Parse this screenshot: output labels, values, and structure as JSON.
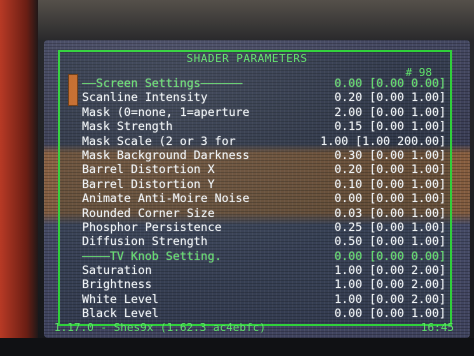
{
  "menu": {
    "title": "SHADER PARAMETERS",
    "page_counter": "# 98",
    "rows": [
      {
        "label": "——Screen Settings——————",
        "value": "0.00 [0.00 0.00]",
        "header": true
      },
      {
        "label": "Scanline Intensity",
        "value": "0.20 [0.00 1.00]"
      },
      {
        "label": "Mask (0=none, 1=aperture",
        "value": "2.00 [0.00 1.00]"
      },
      {
        "label": "Mask Strength",
        "value": "0.15 [0.00 1.00]"
      },
      {
        "label": "Mask Scale (2 or 3 for",
        "value": "1.00 [1.00 200.00]"
      },
      {
        "label": "Mask Background Darkness",
        "value": "0.30 [0.00 1.00]"
      },
      {
        "label": "Barrel Distortion X",
        "value": "0.20 [0.00 1.00]"
      },
      {
        "label": "Barrel Distortion Y",
        "value": "0.10 [0.00 1.00]"
      },
      {
        "label": "Animate Anti-Moire Noise",
        "value": "0.00 [0.00 1.00]"
      },
      {
        "label": "Rounded Corner Size",
        "value": "0.03 [0.00 1.00]"
      },
      {
        "label": "Phosphor Persistence",
        "value": "0.25 [0.00 1.00]"
      },
      {
        "label": "Diffusion Strength",
        "value": "0.50 [0.00 1.00]"
      },
      {
        "label": "————TV Knob Setting.",
        "value": "0.00 [0.00 0.00]",
        "header": true
      },
      {
        "label": "Saturation",
        "value": "1.00 [0.00 2.00]"
      },
      {
        "label": "Brightness",
        "value": "1.00 [0.00 2.00]"
      },
      {
        "label": "White Level",
        "value": "1.00 [0.00 2.00]"
      },
      {
        "label": "Black Level",
        "value": "0.00 [0.00 1.00]"
      }
    ]
  },
  "footer": {
    "version": "1.17.0 - Shes9x (1.62.3 ac4ebfc)",
    "clock": "16:45"
  },
  "colors": {
    "accent": "#2fd03a",
    "text": "#eef2f5"
  }
}
